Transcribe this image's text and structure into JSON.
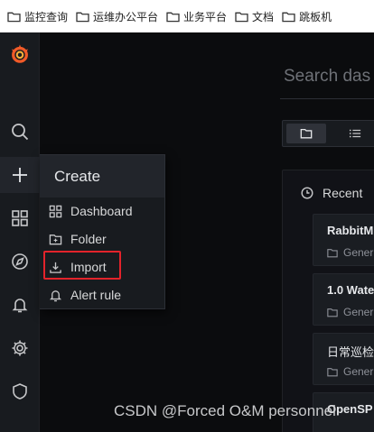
{
  "bookmarks": [
    {
      "label": "监控查询",
      "icon": "folder-icon"
    },
    {
      "label": "运维办公平台",
      "icon": "folder-icon"
    },
    {
      "label": "业务平台",
      "icon": "folder-icon"
    },
    {
      "label": "文档",
      "icon": "folder-icon"
    },
    {
      "label": "跳板机",
      "icon": "folder-icon"
    }
  ],
  "sidemenu": {
    "items": [
      "grafana-logo",
      "search-icon",
      "plus-icon",
      "apps-icon",
      "compass-icon",
      "bell-icon",
      "gear-icon",
      "shield-icon"
    ]
  },
  "create_menu": {
    "header": "Create",
    "items": [
      {
        "label": "Dashboard",
        "icon": "apps-icon"
      },
      {
        "label": "Folder",
        "icon": "folder-plus-icon"
      },
      {
        "label": "Import",
        "icon": "import-icon"
      },
      {
        "label": "Alert rule",
        "icon": "bell-icon"
      }
    ],
    "highlight_color": "#e3232b"
  },
  "main": {
    "search_placeholder": "Search das",
    "view_modes": [
      "folder-view-icon",
      "list-view-icon"
    ],
    "recent": {
      "title": "Recent",
      "items": [
        {
          "title": "RabbitM",
          "folder": "Gener"
        },
        {
          "title": "1.0 Wate",
          "folder": "Gener"
        },
        {
          "title": "日常巡检",
          "folder": "Gener"
        },
        {
          "title": "OpenSP",
          "folder": ""
        }
      ]
    }
  },
  "watermark": "CSDN @Forced O&M personnel",
  "colors": {
    "background": "#0b0c0e",
    "panel": "#181b1f",
    "accent": "#f05a28"
  }
}
